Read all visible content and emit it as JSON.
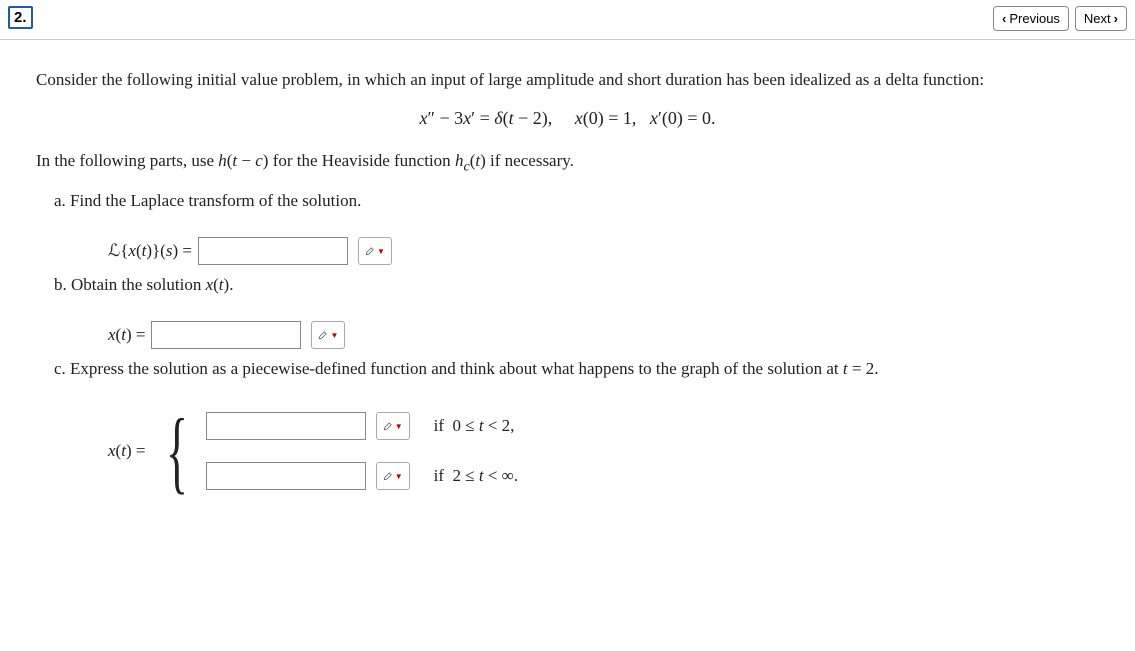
{
  "nav": {
    "question_number": "2.",
    "prev_label": "Previous",
    "next_label": "Next"
  },
  "problem": {
    "intro": "Consider the following initial value problem, in which an input of large amplitude and short duration has been idealized as a delta function:",
    "equation_html": "<span class='mi'>x</span>″ − 3<span class='mi'>x</span>′ = <span class='mi'>δ</span>(<span class='mi'>t</span> − 2), &nbsp;&nbsp;&nbsp; <span class='mi'>x</span>(0) = 1, &nbsp; <span class='mi'>x</span>′(0) = 0.",
    "heaviside_html": "In the following parts, use <span class='mi'>h</span>(<span class='mi'>t</span> − <span class='mi'>c</span>) for the Heaviside function <span class='mi'>h<sub>c</sub></span>(<span class='mi'>t</span>) if necessary."
  },
  "parts": {
    "a": {
      "text": "a. Find the Laplace transform of the solution.",
      "label_html": "ℒ{<span class='mi'>x</span>(<span class='mi'>t</span>)}(<span class='mi'>s</span>) =",
      "value": ""
    },
    "b": {
      "text_html": "b. Obtain the solution <span class='mi'>x</span>(<span class='mi'>t</span>).",
      "label_html": "<span class='mi'>x</span>(<span class='mi'>t</span>) =",
      "value": ""
    },
    "c": {
      "text_html": "c. Express the solution as a piecewise-defined function and think about what happens to the graph of the solution at <span class='mi'>t</span> = 2.",
      "label_html": "<span class='mi'>x</span>(<span class='mi'>t</span>) =",
      "piece1_value": "",
      "piece1_cond_html": "if &nbsp;0 ≤ <span class='mi'>t</span> &lt; 2,",
      "piece2_value": "",
      "piece2_cond_html": "if &nbsp;2 ≤ <span class='mi'>t</span> &lt; ∞."
    }
  }
}
